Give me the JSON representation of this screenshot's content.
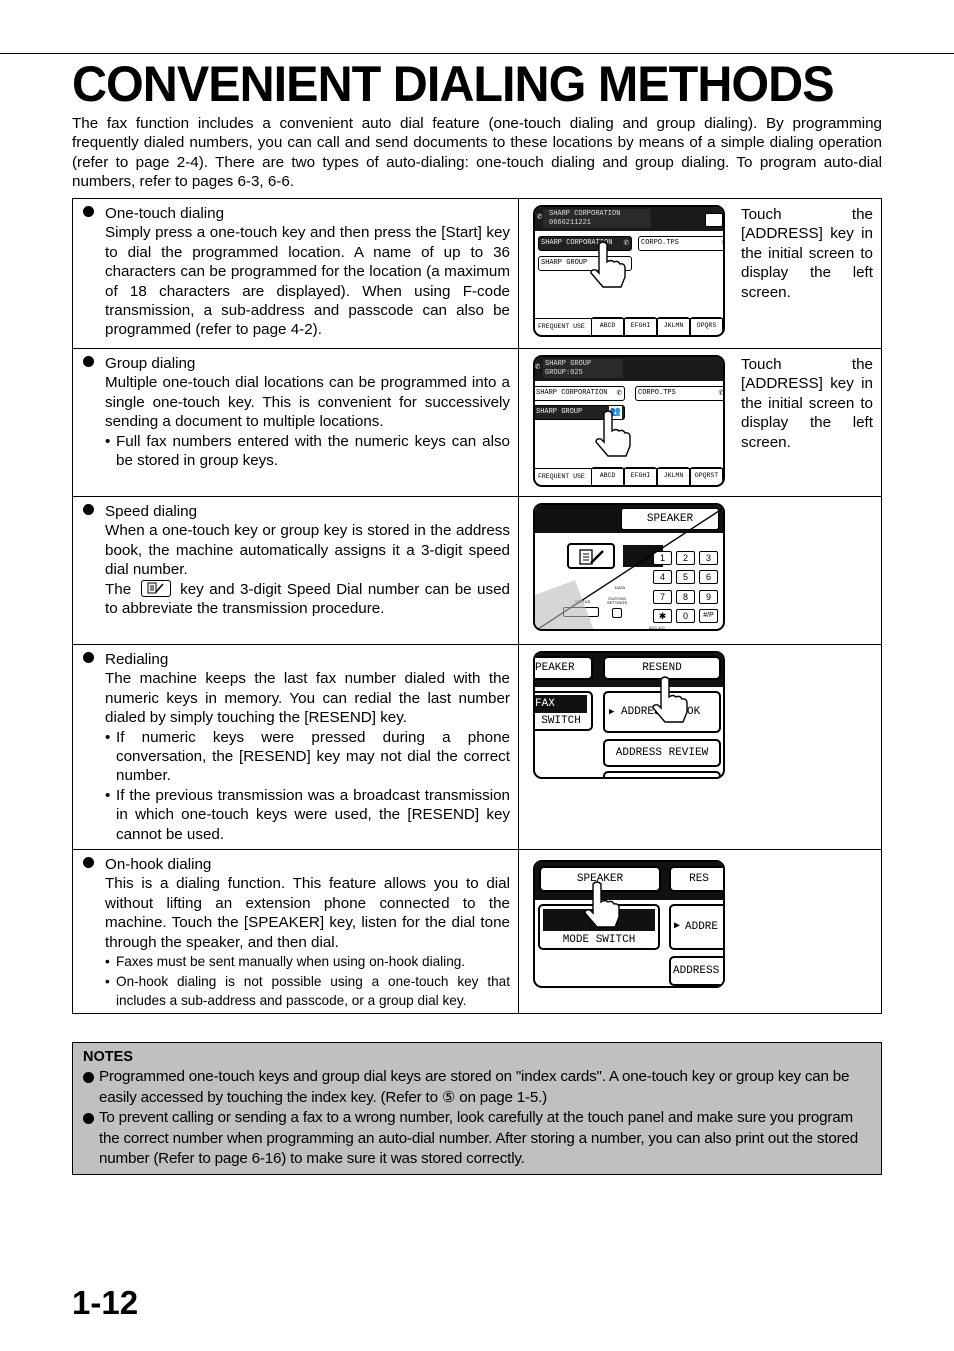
{
  "page": {
    "title": "CONVENIENT DIALING METHODS",
    "intro": "The fax function includes a convenient auto dial feature (one-touch dialing and group dialing). By programming frequently dialed numbers, you can call and send documents to these locations by means of a simple dialing operation (refer to page 2-4). There are two types of auto-dialing: one-touch dialing and group dialing. To program auto-dial numbers, refer to pages 6-3, 6-6.",
    "page_number": "1-12"
  },
  "methods": [
    {
      "title": "One-touch dialing",
      "body": "Simply press a one-touch key and then press the [Start] key to dial the programmed location. A name of up to 36 characters can be programmed for the location (a maximum of 18 characters are displayed). When using F-code transmission, a sub-address and passcode can also be programmed (refer to page 4-2).",
      "side_note": "Touch the [ADDRESS] key in the initial screen to display the left screen.",
      "screen": {
        "header_line1": "SHARP CORPORATION",
        "header_line2": "0666211221",
        "keys": [
          "SHARP CORPORATION",
          "CORPO.TPS",
          "SHARP GROUP"
        ],
        "tabs": [
          "FREQUENT USE",
          "ABCD",
          "EFGHI",
          "JKLMN",
          "OPQRS"
        ]
      }
    },
    {
      "title": "Group dialing",
      "body": "Multiple one-touch dial locations can be programmed into a single one-touch key. This is convenient for successively sending a document to multiple locations.",
      "bullets": [
        "Full fax numbers entered with the numeric keys can also be stored in group keys."
      ],
      "side_note": "Touch the [ADDRESS] key in the initial screen to display the left screen.",
      "screen": {
        "header_line1": "SHARP GROUP",
        "header_line2": "GROUP:025",
        "keys": [
          "SHARP CORPORATION",
          "CORPO.TPS",
          "SHARP GROUP"
        ],
        "tabs": [
          "FREQUENT USE",
          "ABCD",
          "EFGHI",
          "JKLMN",
          "OPQRST"
        ]
      }
    },
    {
      "title": "Speed dialing",
      "body_part1": "When a one-touch key or group key is stored in the address book, the machine automatically assigns it a 3-digit speed dial number.",
      "body_part2_pre": "The",
      "body_part2_post": "key and 3-digit Speed Dial number can be used to abbreviate the transmission procedure.",
      "screen": {
        "speaker_label": "SPEAKER",
        "numpad": [
          "1",
          "2",
          "3",
          "4",
          "5",
          "6",
          "7",
          "8",
          "9",
          "✱",
          "0",
          "#/P"
        ],
        "small_labels": [
          "STATUS",
          "CUSTOM SETTINGS",
          "ACC.#-C",
          "DATA"
        ]
      }
    },
    {
      "title": "Redialing",
      "body": "The machine keeps the last fax number dialed with the numeric keys in memory. You can redial the last number dialed by simply touching the [RESEND] key.",
      "bullets": [
        "If numeric keys were pressed during a phone conversation, the [RESEND] key may not dial the correct number.",
        "If the previous transmission was a broadcast transmission in which one-touch keys were used, the [RESEND] key cannot be used."
      ],
      "screen": {
        "keys": [
          "PEAKER",
          "RESEND",
          "FAX",
          "SWITCH",
          "ADDRESS BOOK",
          "ADDRESS REVIEW"
        ]
      }
    },
    {
      "title": "On-hook dialing",
      "body": "This is a dialing function. This feature allows you to dial without lifting an extension phone connected to the machine. Touch the [SPEAKER] key, listen for the dial tone through the speaker, and then dial.",
      "bullets": [
        "Faxes must be sent manually when using on-hook dialing.",
        "On-hook dialing is not possible using a one-touch key that includes a sub-address and passcode, or a group dial key."
      ],
      "screen": {
        "keys": [
          "SPEAKER",
          "RES",
          "MODE SWITCH",
          "ADDRE",
          "ADDRESS"
        ]
      }
    }
  ],
  "notes": {
    "title": "NOTES",
    "items": [
      "Programmed one-touch keys and group dial keys are stored on \"index cards\". A one-touch key or group key can be easily accessed by touching the index key. (Refer to ⑤ on page 1-5.)",
      "To prevent calling or sending a fax to a wrong number, look carefully at the touch panel and make sure you program the correct number when programming an auto-dial number. After storing a number, you can also print out the stored number (Refer to page 6-16) to make sure it was stored correctly."
    ]
  }
}
